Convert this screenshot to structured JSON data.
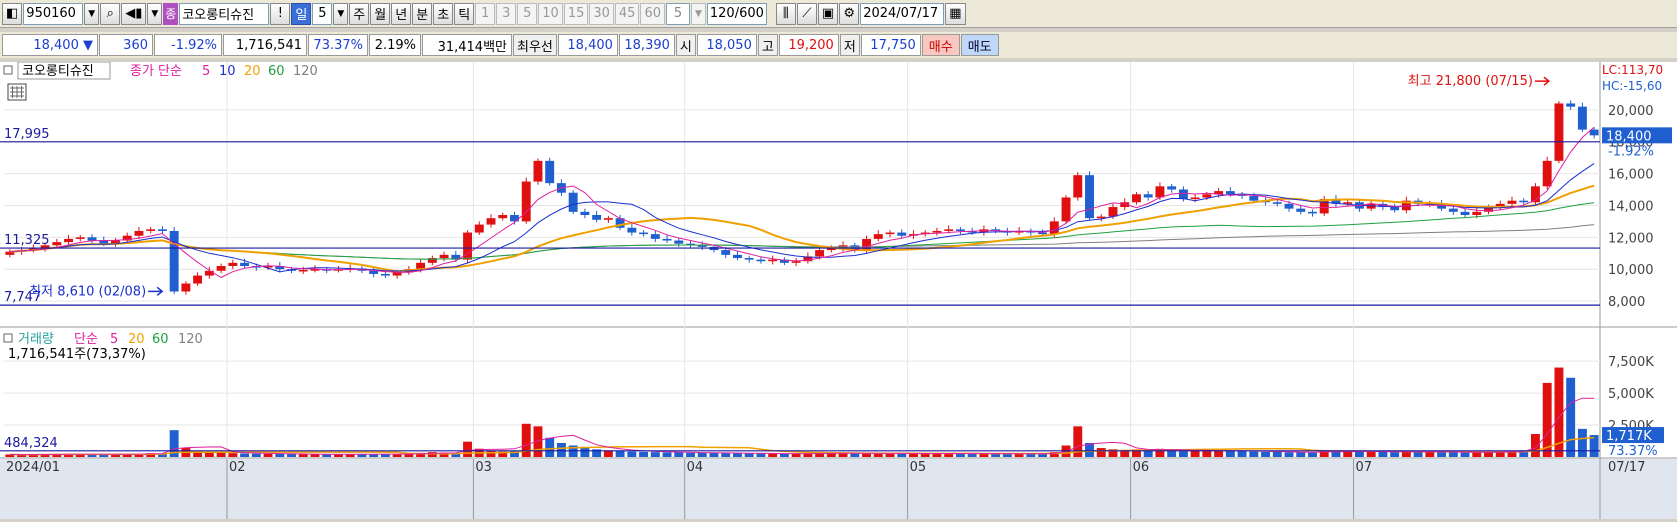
{
  "toolbar": {
    "code": "950160",
    "tag": "종",
    "name": "코오롱티슈진",
    "alert": "!",
    "periods": [
      "일",
      "5",
      "주",
      "월",
      "년",
      "분",
      "초",
      "틱"
    ],
    "minutes": [
      "1",
      "3",
      "5",
      "10",
      "15",
      "30",
      "45",
      "60"
    ],
    "interval": "5",
    "count": "120",
    "count_max": "/600",
    "date": "2024/07/17"
  },
  "quote": {
    "price": "18,400",
    "change_arrow": "▼",
    "change": "360",
    "change_pct": "-1.92%",
    "volume": "1,716,541",
    "volume_ratio": "73.37%",
    "turnover": "2.19%",
    "trade_value": "31,414백만",
    "best_label": "최우선",
    "best_ask": "18,400",
    "best_bid": "18,390",
    "open_label": "시",
    "open": "18,050",
    "high_label": "고",
    "high": "19,200",
    "low_label": "저",
    "low": "17,750",
    "buy_label": "매수",
    "sell_label": "매도"
  },
  "price_panel": {
    "name": "코오롱티슈진",
    "legend_prefix": "종가 단순",
    "ma_labels": [
      "5",
      "10",
      "20",
      "60",
      "120"
    ],
    "lc": "LC:113,70",
    "hc": "HC:-15,60",
    "current_price": "18,400",
    "current_pct": "-1.92%",
    "hline_labels": [
      "17,995",
      "11,325",
      "7,747"
    ],
    "high_note": "최고 21,800 (07/15)",
    "low_note": "최저 8,610 (02/08)"
  },
  "volume_panel": {
    "legend_prefix": "거래량",
    "legend_simple": "단순",
    "ma_labels": [
      "5",
      "20",
      "60",
      "120"
    ],
    "current_text": "1,716,541주(73,37%)",
    "hline_label": "484,324",
    "current_tag": "1,717K",
    "current_pct": "73.37%"
  },
  "x_axis": {
    "labels": [
      "2024/01",
      "02",
      "03",
      "04",
      "05",
      "06",
      "07"
    ],
    "end_label": "07/17"
  },
  "colors": {
    "up": "#e01010",
    "down": "#1f5fd0",
    "ma5": "#e020a0",
    "ma10": "#1a2fd0",
    "ma20": "#f0a000",
    "ma60": "#20a040",
    "ma120": "#808080"
  },
  "chart_data": {
    "type": "candlestick",
    "y_ticks": [
      8000,
      10000,
      12000,
      14000,
      16000,
      18000,
      20000
    ],
    "y_tick_labels": [
      "8,000",
      "10,000",
      "12,000",
      "14,000",
      "16,000",
      "18,000",
      "20,000"
    ],
    "vol_ticks": [
      2500,
      5000,
      7500
    ],
    "vol_tick_labels": [
      "2,500K",
      "5,000K",
      "7,500K"
    ],
    "hlines": [
      17995,
      11325,
      7747
    ],
    "vol_hline": 484,
    "price_range": [
      7000,
      22500
    ],
    "vol_range": [
      0,
      9000
    ],
    "month_starts": [
      0,
      19,
      40,
      58,
      77,
      96,
      115
    ],
    "closes": [
      11100,
      11200,
      11300,
      11500,
      11700,
      11900,
      12000,
      11800,
      11600,
      11800,
      12100,
      12400,
      12500,
      12400,
      8600,
      9100,
      9600,
      9900,
      10200,
      10400,
      10200,
      10100,
      10200,
      10000,
      9900,
      9950,
      10000,
      9950,
      10000,
      10050,
      9900,
      9700,
      9600,
      9800,
      10000,
      10400,
      10700,
      10900,
      10600,
      12300,
      12800,
      13200,
      13400,
      13000,
      15500,
      16800,
      15400,
      14800,
      13600,
      13400,
      13100,
      13200,
      12600,
      12300,
      12200,
      11900,
      11800,
      11600,
      11500,
      11400,
      11200,
      10900,
      10700,
      10600,
      10500,
      10600,
      10400,
      10500,
      10800,
      11200,
      11300,
      11500,
      11200,
      11900,
      12200,
      12300,
      12100,
      12200,
      12300,
      12400,
      12500,
      12400,
      12300,
      12500,
      12400,
      12300,
      12400,
      12300,
      12200,
      13000,
      14500,
      15900,
      13200,
      13300,
      13900,
      14200,
      14700,
      14500,
      15200,
      15000,
      14400,
      14500,
      14700,
      14900,
      14700,
      14600,
      14300,
      14200,
      14100,
      13800,
      13600,
      13500,
      14400,
      14100,
      14200,
      13800,
      14100,
      13900,
      13700,
      14300,
      14100,
      14100,
      13800,
      13600,
      13400,
      13600,
      13900,
      14100,
      14300,
      14200,
      15200,
      16800,
      20400,
      20200,
      18760,
      18400
    ],
    "volumes": [
      200,
      180,
      190,
      210,
      220,
      240,
      210,
      180,
      190,
      230,
      250,
      270,
      300,
      280,
      2100,
      700,
      450,
      380,
      330,
      300,
      280,
      260,
      250,
      240,
      230,
      220,
      210,
      200,
      210,
      220,
      240,
      230,
      220,
      230,
      260,
      320,
      380,
      350,
      300,
      1200,
      650,
      480,
      420,
      460,
      2600,
      2400,
      1500,
      1100,
      900,
      700,
      600,
      520,
      480,
      420,
      400,
      380,
      360,
      350,
      330,
      320,
      310,
      300,
      290,
      280,
      270,
      260,
      250,
      260,
      290,
      320,
      300,
      280,
      270,
      300,
      290,
      280,
      270,
      260,
      270,
      280,
      290,
      280,
      270,
      260,
      250,
      260,
      270,
      260,
      250,
      380,
      900,
      2400,
      1100,
      700,
      600,
      550,
      600,
      520,
      640,
      560,
      450,
      480,
      510,
      500,
      470,
      460,
      420,
      400,
      390,
      370,
      350,
      340,
      520,
      450,
      440,
      400,
      420,
      390,
      380,
      430,
      410,
      400,
      380,
      360,
      340,
      360,
      380,
      420,
      500,
      460,
      1800,
      5800,
      7000,
      6200,
      2200,
      1717
    ]
  }
}
